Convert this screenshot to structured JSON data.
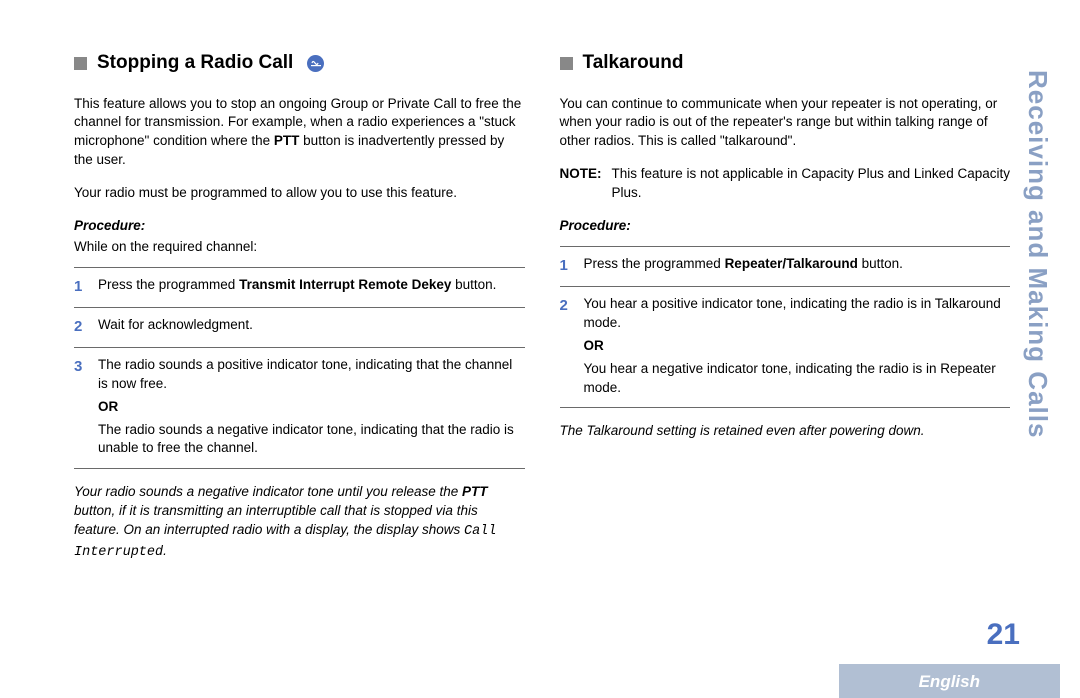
{
  "sideTitle": "Receiving and Making Calls",
  "pageNum": "21",
  "langTab": "English",
  "left": {
    "heading": "Stopping a Radio Call",
    "p1a": "This feature allows you to stop an ongoing Group or Private Call to free the channel for transmission. For example, when a radio experiences a \"stuck microphone\" condition where the ",
    "p1b": "PTT",
    "p1c": " button is inadvertently pressed by the user.",
    "p2": "Your radio must be programmed to allow you to use this feature.",
    "procLabel": "Procedure:",
    "procIntro": "While on the required channel:",
    "step1a": "Press the programmed ",
    "step1b": "Transmit Interrupt Remote Dekey",
    "step1c": " button.",
    "step2": "Wait for acknowledgment.",
    "step3a": "The radio sounds a positive indicator tone, indicating that the channel is now free.",
    "or": "OR",
    "step3b": "The radio sounds a negative indicator tone, indicating that the radio is unable to free the channel.",
    "note1a": "Your radio sounds a negative indicator tone until you release the ",
    "note1b": "PTT",
    "note1c": " button, if it is transmitting an interruptible call that is stopped via this feature. On an interrupted radio with a display, the display shows ",
    "note1d": "Call Interrupted",
    "note1e": "."
  },
  "right": {
    "heading": "Talkaround",
    "p1": "You can continue to communicate when your repeater is not operating, or when your radio is out of the repeater's range but within talking range of other radios. This is called \"talkaround\".",
    "noteLabel": "NOTE:",
    "noteText": "This feature is not applicable in Capacity Plus and Linked Capacity Plus.",
    "procLabel": "Procedure:",
    "step1a": "Press the programmed ",
    "step1b": "Repeater/Talkaround",
    "step1c": " button.",
    "step2a": "You hear a positive indicator tone, indicating the radio is in Talkaround mode.",
    "or": "OR",
    "step2b": "You hear a negative indicator tone, indicating the radio is in Repeater mode.",
    "note2": "The Talkaround setting is retained even after powering down."
  }
}
